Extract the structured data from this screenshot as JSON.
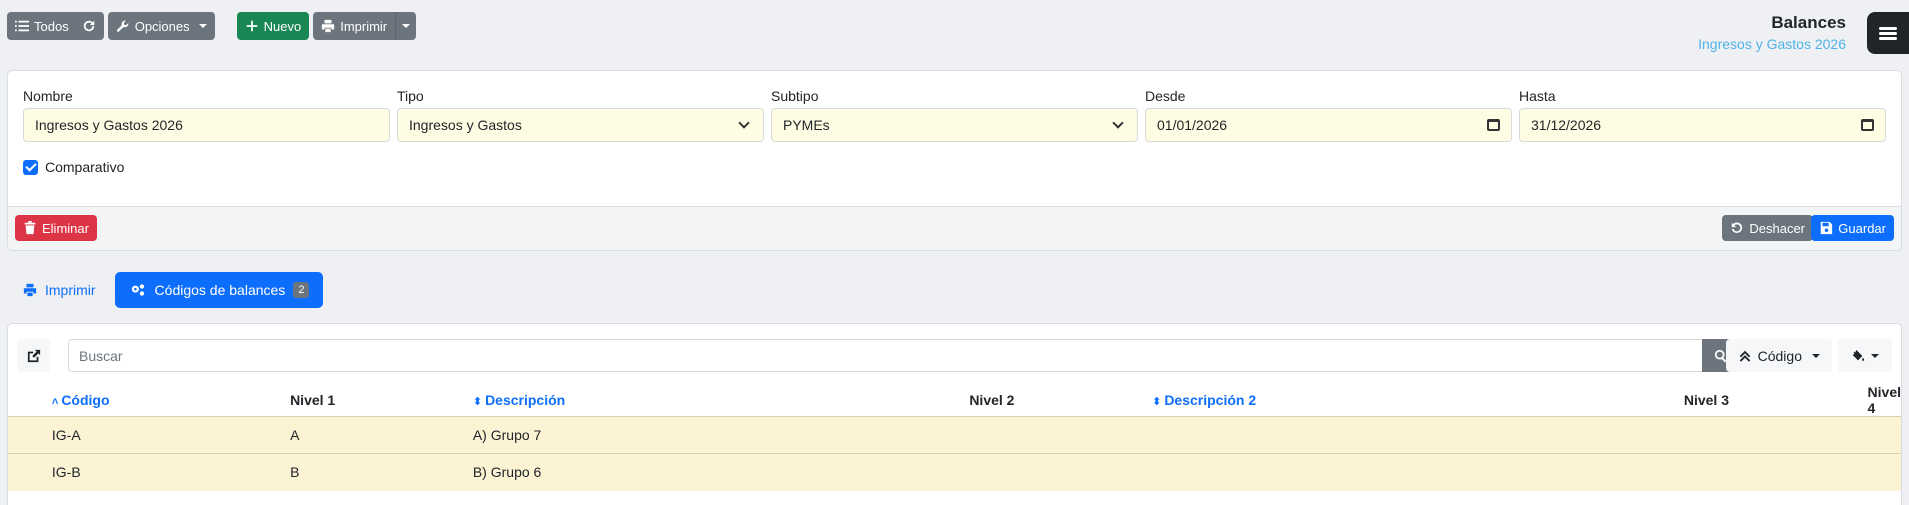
{
  "toolbar": {
    "todos": "Todos",
    "opciones": "Opciones",
    "nuevo": "Nuevo",
    "imprimir": "Imprimir"
  },
  "header": {
    "title": "Balances",
    "subtitle": "Ingresos y Gastos 2026"
  },
  "form": {
    "nombre_label": "Nombre",
    "nombre_value": "Ingresos y Gastos 2026",
    "tipo_label": "Tipo",
    "tipo_value": "Ingresos y Gastos",
    "subtipo_label": "Subtipo",
    "subtipo_value": "PYMEs",
    "desde_label": "Desde",
    "desde_value": "01/01/2026",
    "hasta_label": "Hasta",
    "hasta_value": "31/12/2026",
    "comparativo_label": "Comparativo",
    "comparativo_checked": true,
    "eliminar": "Eliminar",
    "deshacer": "Deshacer",
    "guardar": "Guardar"
  },
  "tabs": {
    "imprimir": "Imprimir",
    "codigos": "Códigos de balances",
    "codigos_count": "2"
  },
  "list": {
    "search_placeholder": "Buscar",
    "order_label": "Código",
    "columns": [
      "Código",
      "Nivel 1",
      "Descripción",
      "Nivel 2",
      "Descripción 2",
      "Nivel 3",
      "Nivel 4"
    ],
    "rows": [
      {
        "codigo": "IG-A",
        "nivel1": "A",
        "descripcion": "A) Grupo 7",
        "nivel2": "",
        "descripcion2": "",
        "nivel3": "",
        "nivel4": ""
      },
      {
        "codigo": "IG-B",
        "nivel1": "B",
        "descripcion": "B) Grupo 6",
        "nivel2": "",
        "descripcion2": "",
        "nivel3": "",
        "nivel4": ""
      }
    ]
  },
  "colors": {
    "primary": "#0d6efd",
    "success": "#198754",
    "danger": "#dc3545",
    "secondary": "#6c757d",
    "row_highlight": "#fcf3d4",
    "input_bg": "#fefde3"
  }
}
